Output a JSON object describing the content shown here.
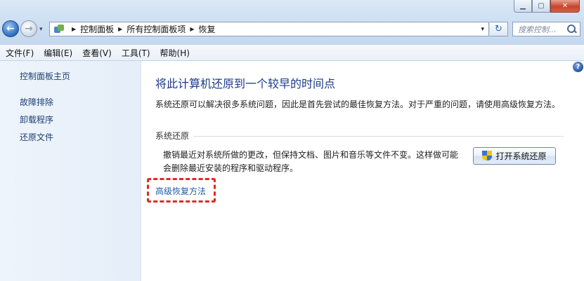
{
  "window": {
    "min_glyph": "▁",
    "max_glyph": "▢",
    "close_glyph": "✕"
  },
  "nav": {
    "back_glyph": "←",
    "forward_glyph": "→",
    "recent_glyph": "▾"
  },
  "address": {
    "separator": "▶",
    "crumbs": [
      "控制面板",
      "所有控制面板项",
      "恢复"
    ],
    "dropdown_glyph": "▾",
    "refresh_glyph": "↻"
  },
  "search": {
    "placeholder": "搜索控制..."
  },
  "menubar": {
    "items": [
      "文件(F)",
      "编辑(E)",
      "查看(V)",
      "工具(T)",
      "帮助(H)"
    ]
  },
  "sidebar": {
    "home": "控制面板主页",
    "links": [
      "故障排除",
      "卸载程序",
      "还原文件"
    ]
  },
  "main": {
    "help_glyph": "?",
    "title": "将此计算机还原到一个较早的时间点",
    "intro": "系统还原可以解决很多系统问题，因此是首先尝试的最佳恢复方法。对于严重的问题，请使用高级恢复方法。",
    "section_title": "系统还原",
    "section_desc": [
      "撤销最近对系统所做的更改，但保持文档、图片和音乐等文件不变。这样做可能",
      "会删除最近安装的程序和驱动程序。"
    ],
    "open_restore_button": "打开系统还原",
    "advanced_link": "高级恢复方法"
  },
  "colors": {
    "link": "#1f5ca8",
    "title": "#1b3a8a",
    "highlight": "#e02a22"
  }
}
